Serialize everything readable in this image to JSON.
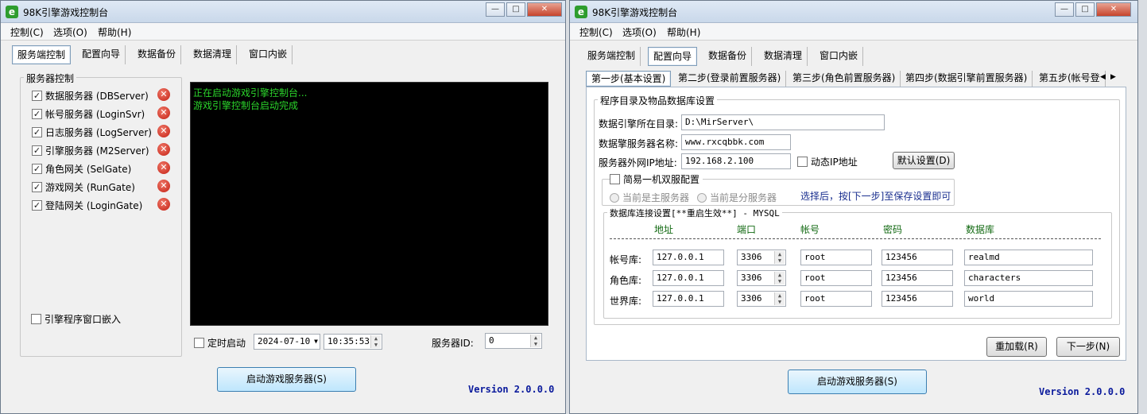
{
  "left_window": {
    "title": "98K引擎游戏控制台",
    "menu": [
      "控制(C)",
      "选项(O)",
      "帮助(H)"
    ],
    "tabs": [
      "服务端控制",
      "配置向导",
      "数据备份",
      "数据清理",
      "窗口内嵌"
    ],
    "group_label": "服务器控制",
    "servers": [
      {
        "label": "数据服务器 (DBServer)",
        "checked": true
      },
      {
        "label": "帐号服务器 (LoginSvr)",
        "checked": true
      },
      {
        "label": "日志服务器 (LogServer)",
        "checked": true
      },
      {
        "label": "引擎服务器 (M2Server)",
        "checked": true
      },
      {
        "label": "角色网关 (SelGate)",
        "checked": true
      },
      {
        "label": "游戏网关 (RunGate)",
        "checked": true
      },
      {
        "label": "登陆网关 (LoginGate)",
        "checked": true
      }
    ],
    "embed_checkbox": "引擎程序窗口嵌入",
    "console_lines": [
      "正在启动游戏引擎控制台...",
      "游戏引擎控制台启动完成"
    ],
    "timed_start": "定时启动",
    "date": "2024-07-10",
    "time": "10:35:53",
    "server_id_label": "服务器ID:",
    "server_id": "0",
    "start_button": "启动游戏服务器(S)",
    "version": "Version 2.0.0.0"
  },
  "right_window": {
    "title": "98K引擎游戏控制台",
    "menu": [
      "控制(C)",
      "选项(O)",
      "帮助(H)"
    ],
    "tabs": [
      "服务端控制",
      "配置向导",
      "数据备份",
      "数据清理",
      "窗口内嵌"
    ],
    "step_tabs": [
      "第一步(基本设置)",
      "第二步(登录前置服务器)",
      "第三步(角色前置服务器)",
      "第四步(数据引擎前置服务器)",
      "第五步(帐号登"
    ],
    "section_title": "程序目录及物品数据库设置",
    "engine_dir_label": "数据引擎所在目录:",
    "engine_dir": "D:\\MirServer\\",
    "server_name_label": "数据擎服务器名称:",
    "server_name": "www.rxcqbbk.com",
    "external_ip_label": "服务器外网IP地址:",
    "external_ip": "192.168.2.100",
    "dynamic_ip": "动态IP地址",
    "default_button": "默认设置(D)",
    "dual_config": "简易一机双服配置",
    "radio_main": "当前是主服务器",
    "radio_sub": "当前是分服务器",
    "hint": "选择后，按[下一步]至保存设置即可",
    "db_title": "数据库连接设置[**重启生效**] - MYSQL",
    "db_headers": [
      "地址",
      "端口",
      "帐号",
      "密码",
      "数据库"
    ],
    "db_rows": [
      {
        "label": "帐号库:",
        "addr": "127.0.0.1",
        "port": "3306",
        "user": "root",
        "pass": "123456",
        "db": "realmd"
      },
      {
        "label": "角色库:",
        "addr": "127.0.0.1",
        "port": "3306",
        "user": "root",
        "pass": "123456",
        "db": "characters"
      },
      {
        "label": "世界库:",
        "addr": "127.0.0.1",
        "port": "3306",
        "user": "root",
        "pass": "123456",
        "db": "world"
      }
    ],
    "reload_button": "重加载(R)",
    "next_button": "下一步(N)",
    "start_button": "启动游戏服务器(S)",
    "version": "Version 2.0.0.0"
  }
}
